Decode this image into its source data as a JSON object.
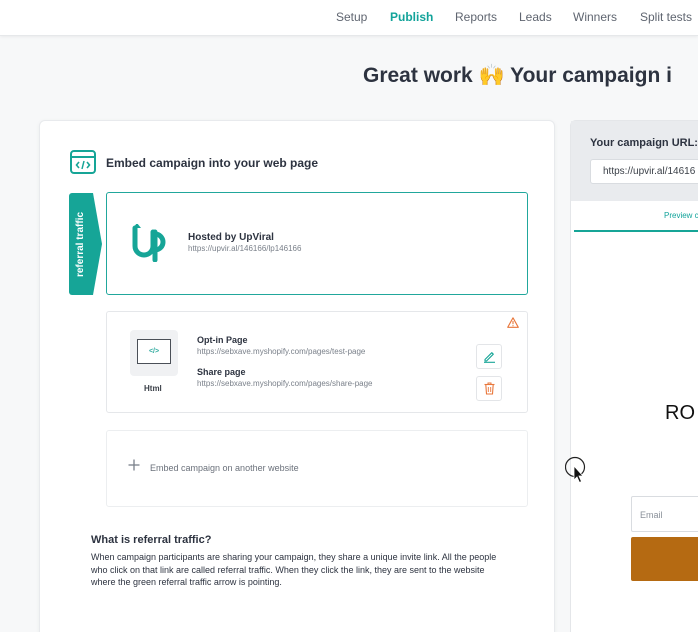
{
  "nav": {
    "tabs": [
      {
        "label": "Setup",
        "active": false
      },
      {
        "label": "Publish",
        "active": true
      },
      {
        "label": "Reports",
        "active": false
      },
      {
        "label": "Leads",
        "active": false
      },
      {
        "label": "Winners",
        "active": false
      },
      {
        "label": "Split tests",
        "active": false
      }
    ]
  },
  "headline": "Great work 🙌 Your campaign i",
  "embed": {
    "title": "Embed campaign into your web page",
    "referral_tab_label": "referral traffic",
    "hosted": {
      "title": "Hosted by UpViral",
      "url": "https://upvir.al/146166/lp146166"
    },
    "html_entry": {
      "thumb_label": "Html",
      "optin_title": "Opt-in Page",
      "optin_url": "https://sebxave.myshopify.com/pages/test-page",
      "share_title": "Share page",
      "share_url": "https://sebxave.myshopify.com/pages/share-page"
    },
    "add_label": "Embed campaign on another website"
  },
  "referral_help": {
    "question": "What is referral traffic?",
    "answer": "When campaign participants are sharing your campaign, they share a unique invite link. All the people who click on that link are called referral traffic. When they click the link, they are sent to the website where the green referral traffic arrow is pointing."
  },
  "right_panel": {
    "url_label": "Your campaign URL:",
    "url_value": "https://upvir.al/14616",
    "preview_tab": "Preview c",
    "preview_heading": "RO",
    "email_placeholder": "Email"
  },
  "colors": {
    "accent": "#12a39a",
    "warning": "#e8763a",
    "button_brown": "#b56a12"
  },
  "icons": [
    "embed-code-icon",
    "upviral-logo",
    "warning-icon",
    "html-code-icon",
    "edit-pencil-icon",
    "trash-icon",
    "plus-icon",
    "mouse-cursor"
  ]
}
